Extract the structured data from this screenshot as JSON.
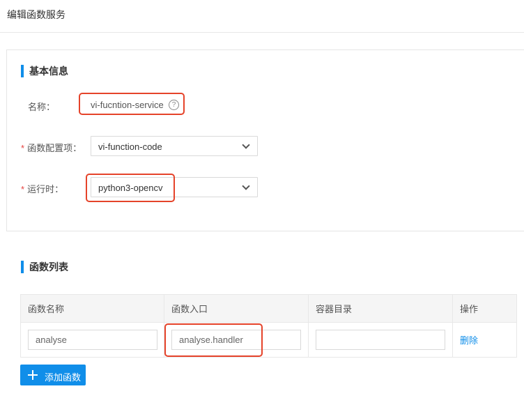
{
  "page": {
    "title": "编辑函数服务"
  },
  "basic_info": {
    "section_title": "基本信息",
    "name": {
      "label": "名称：",
      "value": "vi-fucntion-service",
      "help_icon": "question-circle-icon"
    },
    "function_config": {
      "label": "函数配置项：",
      "required_mark": "*",
      "selected": "vi-function-code"
    },
    "runtime": {
      "label": "运行时：",
      "required_mark": "*",
      "selected": "python3-opencv"
    }
  },
  "function_list": {
    "section_title": "函数列表",
    "columns": [
      "函数名称",
      "函数入口",
      "容器目录",
      "操作"
    ],
    "rows": [
      {
        "name": "analyse",
        "entry": "analyse.handler",
        "container_dir": "",
        "action": "删除"
      }
    ],
    "add_button": "添加函数"
  },
  "colors": {
    "accent": "#108ee9",
    "highlight": "#e5432a",
    "required": "#e64340"
  }
}
